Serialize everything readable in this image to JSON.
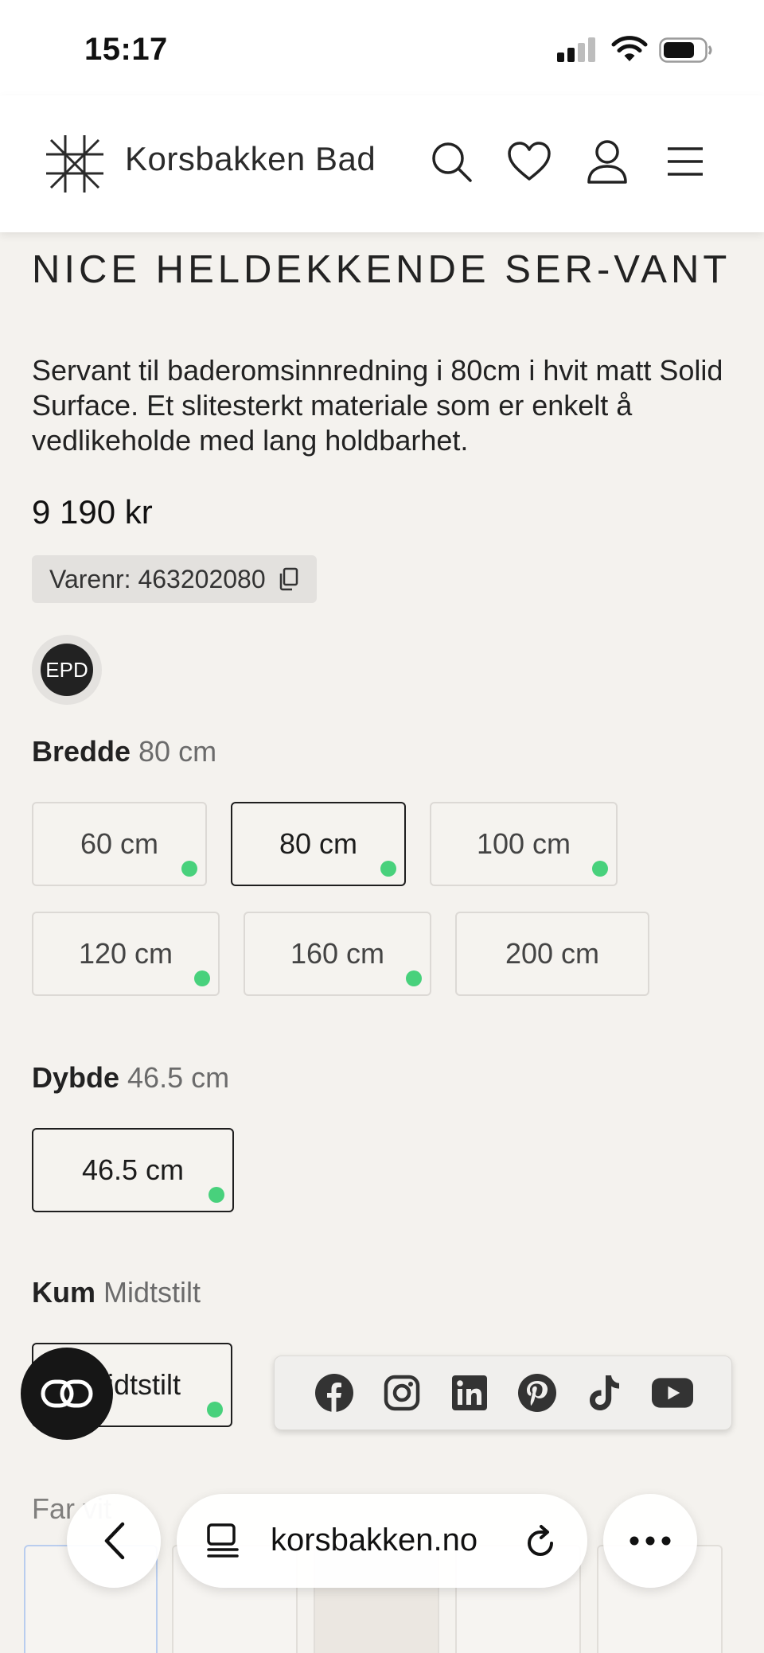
{
  "status": {
    "time": "15:17"
  },
  "header": {
    "brand": "Korsbakken Bad"
  },
  "product": {
    "title": "NICE HELDEKKENDE SER-VANT",
    "description": "Servant til baderomsinnredning i 80cm i hvit matt Solid Surface. Et slitesterkt materiale som er enkelt å vedlikeholde med lang holdbarhet.",
    "price": "9 190 kr",
    "sku": "Varenr: 463202080",
    "epd": "EPD"
  },
  "options": {
    "width": {
      "label": "Bredde",
      "value": "80 cm",
      "choices": [
        {
          "label": "60 cm",
          "in_stock": true,
          "selected": false
        },
        {
          "label": "80 cm",
          "in_stock": true,
          "selected": true
        },
        {
          "label": "100 cm",
          "in_stock": true,
          "selected": false
        },
        {
          "label": "120 cm",
          "in_stock": true,
          "selected": false
        },
        {
          "label": "160 cm",
          "in_stock": true,
          "selected": false
        },
        {
          "label": "200 cm",
          "in_stock": false,
          "selected": false
        }
      ]
    },
    "depth": {
      "label": "Dybde",
      "value": "46.5 cm",
      "choices": [
        {
          "label": "46.5 cm",
          "in_stock": true,
          "selected": true
        }
      ]
    },
    "basin": {
      "label": "Kum",
      "value": "Midtstilt",
      "choices": [
        {
          "label": "Midtstilt",
          "in_stock": true,
          "selected": true
        }
      ]
    },
    "color": {
      "label": "Far",
      "value": "vit"
    }
  },
  "social": [
    "facebook-icon",
    "instagram-icon",
    "linkedin-icon",
    "pinterest-icon",
    "tiktok-icon",
    "youtube-icon"
  ],
  "browser": {
    "url": "korsbakken.no"
  },
  "colors": {
    "in_stock": "#48d17c",
    "background": "#f4f2ee",
    "selected_border": "#1e1e1e"
  }
}
